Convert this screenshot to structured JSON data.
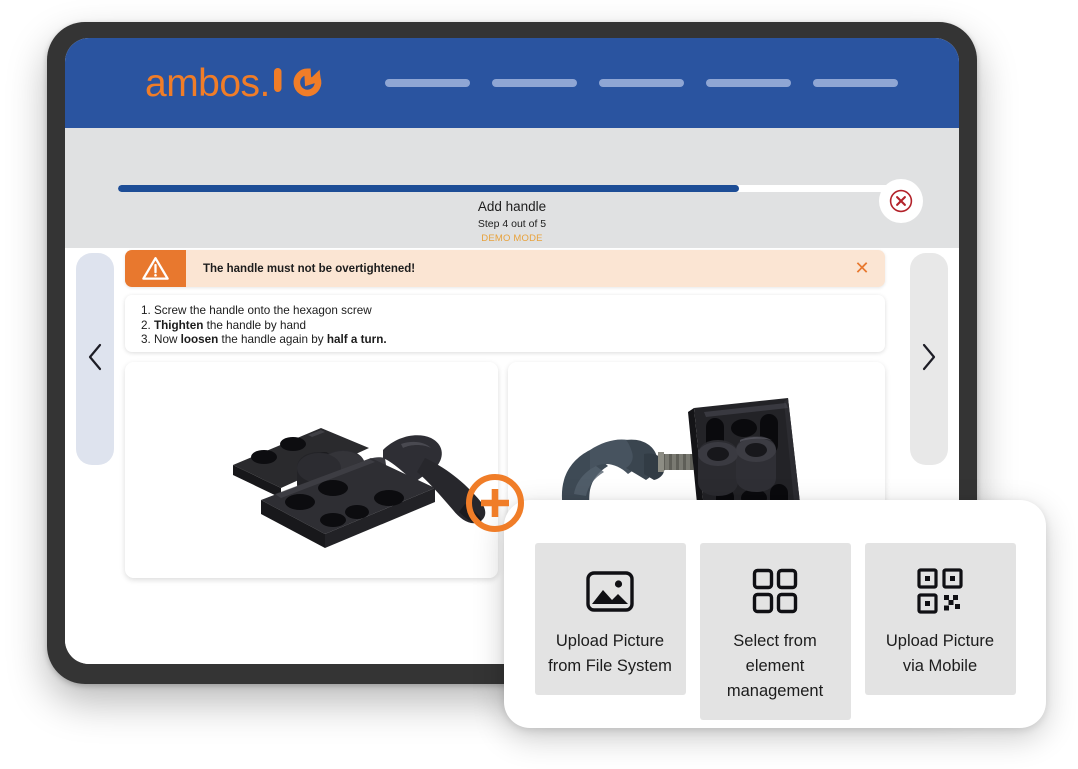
{
  "header": {
    "brand_text": "ambos.",
    "brand_mark": "io-gauge-logo",
    "brand_color": "#f07d28",
    "bar_color": "#2a54a0",
    "nav_placeholders": [
      "",
      "",
      "",
      "",
      ""
    ]
  },
  "progress": {
    "percent": 80,
    "step_title": "Add handle",
    "step_counter": "Step 4 out of 5",
    "demo_mode": "DEMO MODE",
    "demo_mode_color": "#e8a23c",
    "fill_color": "#1d4d96",
    "close_label": "close-step"
  },
  "warning": {
    "message": "The handle must not be overtightened!",
    "icon": "warning-triangle-icon",
    "close_glyph": "✕",
    "accent_color": "#e8782e",
    "background_color": "#fbe5d3"
  },
  "instructions": [
    {
      "number": "1.",
      "pre": "Screw the handle onto the hexagon screw",
      "bold": "",
      "post": ""
    },
    {
      "number": "2.",
      "pre": "",
      "bold": "Thighten",
      "post": " the handle by hand"
    },
    {
      "number": "3.",
      "pre": "Now ",
      "bold": "loosen",
      "post": " the handle again by ",
      "bold2": "half a turn."
    }
  ],
  "media": {
    "left_card_alt": "black mounting bracket with clamp handle attached",
    "right_card_alt": "clamp handle detached beside black mounting bracket"
  },
  "navigation": {
    "prev_glyph": "‹",
    "next_glyph": "›",
    "prev_label": "previous step",
    "next_label": "next step"
  },
  "add_media": {
    "glyph": "+",
    "label": "add picture",
    "color": "#f07d28"
  },
  "upload_options": [
    {
      "id": "file-system",
      "icon": "image-picture-icon",
      "line1": "Upload Picture",
      "line2": "from File System",
      "line3": ""
    },
    {
      "id": "element-management",
      "icon": "grid-squares-icon",
      "line1": "Select from",
      "line2": "element",
      "line3": "management"
    },
    {
      "id": "mobile",
      "icon": "qr-code-icon",
      "line1": "Upload Picture",
      "line2": "via Mobile",
      "line3": ""
    }
  ]
}
